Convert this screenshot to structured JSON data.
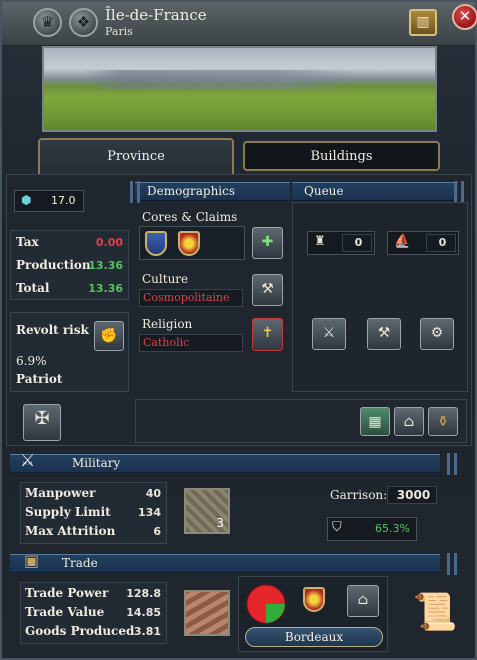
{
  "header": {
    "title": "Île-de-France",
    "subtitle": "Paris"
  },
  "tabs": [
    {
      "label": "Province",
      "active": true
    },
    {
      "label": "Buildings",
      "active": false
    }
  ],
  "development": {
    "total": "17.0"
  },
  "economy": {
    "tax_label": "Tax",
    "tax_value": "0.00",
    "production_label": "Production",
    "production_value": "13.36",
    "total_label": "Total",
    "total_value": "13.36"
  },
  "revolt": {
    "label": "Revolt risk",
    "value": "6.9%",
    "faction": "Patriot"
  },
  "demographics": {
    "title": "Demographics",
    "cores_label": "Cores & Claims",
    "culture_label": "Culture",
    "culture_value": "Cosmopolitaine",
    "religion_label": "Religion",
    "religion_value": "Catholic"
  },
  "queue": {
    "title": "Queue",
    "land_units": "0",
    "naval_units": "0"
  },
  "military": {
    "title": "Military",
    "manpower_label": "Manpower",
    "manpower_value": "40",
    "supply_label": "Supply Limit",
    "supply_value": "134",
    "attrition_label": "Max Attrition",
    "attrition_value": "6",
    "fort_level": "3",
    "garrison_label": "Garrison:",
    "garrison_value": "3000",
    "fort_progress": "65.3%"
  },
  "trade": {
    "title": "Trade",
    "power_label": "Trade Power",
    "power_value": "128.8",
    "value_label": "Trade Value",
    "value_value": "14.85",
    "goods_label": "Goods Produced",
    "goods_value": "3.81",
    "node": "Bordeaux"
  },
  "colors": {
    "positive": "#57c15f",
    "negative": "#e0434a",
    "accent_blue": "#22405e",
    "gold": "#c9b26a"
  }
}
